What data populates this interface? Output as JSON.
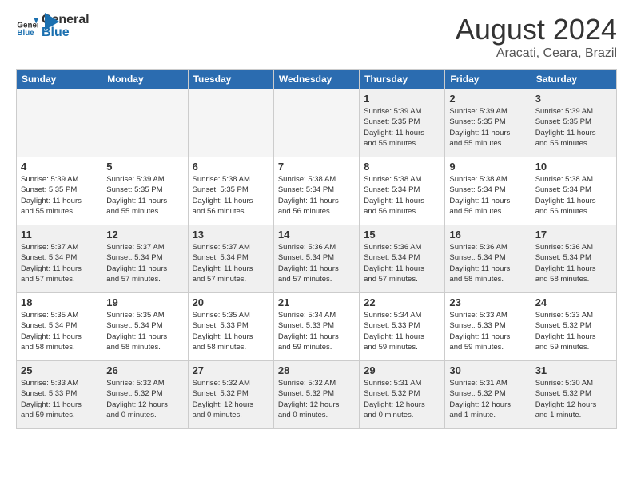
{
  "header": {
    "logo_general": "General",
    "logo_blue": "Blue",
    "month_year": "August 2024",
    "location": "Aracati, Ceara, Brazil"
  },
  "weekdays": [
    "Sunday",
    "Monday",
    "Tuesday",
    "Wednesday",
    "Thursday",
    "Friday",
    "Saturday"
  ],
  "weeks": [
    [
      {
        "day": "",
        "empty": true
      },
      {
        "day": "",
        "empty": true
      },
      {
        "day": "",
        "empty": true
      },
      {
        "day": "",
        "empty": true
      },
      {
        "day": "1",
        "info": "Sunrise: 5:39 AM\nSunset: 5:35 PM\nDaylight: 11 hours\nand 55 minutes."
      },
      {
        "day": "2",
        "info": "Sunrise: 5:39 AM\nSunset: 5:35 PM\nDaylight: 11 hours\nand 55 minutes."
      },
      {
        "day": "3",
        "info": "Sunrise: 5:39 AM\nSunset: 5:35 PM\nDaylight: 11 hours\nand 55 minutes."
      }
    ],
    [
      {
        "day": "4",
        "info": "Sunrise: 5:39 AM\nSunset: 5:35 PM\nDaylight: 11 hours\nand 55 minutes."
      },
      {
        "day": "5",
        "info": "Sunrise: 5:39 AM\nSunset: 5:35 PM\nDaylight: 11 hours\nand 55 minutes."
      },
      {
        "day": "6",
        "info": "Sunrise: 5:38 AM\nSunset: 5:35 PM\nDaylight: 11 hours\nand 56 minutes."
      },
      {
        "day": "7",
        "info": "Sunrise: 5:38 AM\nSunset: 5:34 PM\nDaylight: 11 hours\nand 56 minutes."
      },
      {
        "day": "8",
        "info": "Sunrise: 5:38 AM\nSunset: 5:34 PM\nDaylight: 11 hours\nand 56 minutes."
      },
      {
        "day": "9",
        "info": "Sunrise: 5:38 AM\nSunset: 5:34 PM\nDaylight: 11 hours\nand 56 minutes."
      },
      {
        "day": "10",
        "info": "Sunrise: 5:38 AM\nSunset: 5:34 PM\nDaylight: 11 hours\nand 56 minutes."
      }
    ],
    [
      {
        "day": "11",
        "info": "Sunrise: 5:37 AM\nSunset: 5:34 PM\nDaylight: 11 hours\nand 57 minutes."
      },
      {
        "day": "12",
        "info": "Sunrise: 5:37 AM\nSunset: 5:34 PM\nDaylight: 11 hours\nand 57 minutes."
      },
      {
        "day": "13",
        "info": "Sunrise: 5:37 AM\nSunset: 5:34 PM\nDaylight: 11 hours\nand 57 minutes."
      },
      {
        "day": "14",
        "info": "Sunrise: 5:36 AM\nSunset: 5:34 PM\nDaylight: 11 hours\nand 57 minutes."
      },
      {
        "day": "15",
        "info": "Sunrise: 5:36 AM\nSunset: 5:34 PM\nDaylight: 11 hours\nand 57 minutes."
      },
      {
        "day": "16",
        "info": "Sunrise: 5:36 AM\nSunset: 5:34 PM\nDaylight: 11 hours\nand 58 minutes."
      },
      {
        "day": "17",
        "info": "Sunrise: 5:36 AM\nSunset: 5:34 PM\nDaylight: 11 hours\nand 58 minutes."
      }
    ],
    [
      {
        "day": "18",
        "info": "Sunrise: 5:35 AM\nSunset: 5:34 PM\nDaylight: 11 hours\nand 58 minutes."
      },
      {
        "day": "19",
        "info": "Sunrise: 5:35 AM\nSunset: 5:34 PM\nDaylight: 11 hours\nand 58 minutes."
      },
      {
        "day": "20",
        "info": "Sunrise: 5:35 AM\nSunset: 5:33 PM\nDaylight: 11 hours\nand 58 minutes."
      },
      {
        "day": "21",
        "info": "Sunrise: 5:34 AM\nSunset: 5:33 PM\nDaylight: 11 hours\nand 59 minutes."
      },
      {
        "day": "22",
        "info": "Sunrise: 5:34 AM\nSunset: 5:33 PM\nDaylight: 11 hours\nand 59 minutes."
      },
      {
        "day": "23",
        "info": "Sunrise: 5:33 AM\nSunset: 5:33 PM\nDaylight: 11 hours\nand 59 minutes."
      },
      {
        "day": "24",
        "info": "Sunrise: 5:33 AM\nSunset: 5:32 PM\nDaylight: 11 hours\nand 59 minutes."
      }
    ],
    [
      {
        "day": "25",
        "info": "Sunrise: 5:33 AM\nSunset: 5:33 PM\nDaylight: 11 hours\nand 59 minutes."
      },
      {
        "day": "26",
        "info": "Sunrise: 5:32 AM\nSunset: 5:32 PM\nDaylight: 12 hours\nand 0 minutes."
      },
      {
        "day": "27",
        "info": "Sunrise: 5:32 AM\nSunset: 5:32 PM\nDaylight: 12 hours\nand 0 minutes."
      },
      {
        "day": "28",
        "info": "Sunrise: 5:32 AM\nSunset: 5:32 PM\nDaylight: 12 hours\nand 0 minutes."
      },
      {
        "day": "29",
        "info": "Sunrise: 5:31 AM\nSunset: 5:32 PM\nDaylight: 12 hours\nand 0 minutes."
      },
      {
        "day": "30",
        "info": "Sunrise: 5:31 AM\nSunset: 5:32 PM\nDaylight: 12 hours\nand 1 minute."
      },
      {
        "day": "31",
        "info": "Sunrise: 5:30 AM\nSunset: 5:32 PM\nDaylight: 12 hours\nand 1 minute."
      }
    ]
  ]
}
